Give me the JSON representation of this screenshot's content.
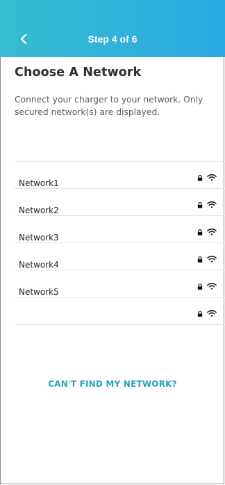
{
  "header": {
    "title": "Step 4 of 6",
    "back_icon": "chevron-left-icon",
    "gradient": [
      "#36bcd0",
      "#2aa9e3"
    ]
  },
  "page": {
    "title": "Choose A Network",
    "subtitle": "Connect your charger to your network.  Only secured network(s) are displayed."
  },
  "networks": [
    {
      "name": "Network1",
      "icons": [
        "lock-icon",
        "wifi-icon"
      ]
    },
    {
      "name": "Network2",
      "icons": [
        "lock-icon",
        "wifi-icon"
      ]
    },
    {
      "name": "Network3",
      "icons": [
        "lock-icon",
        "wifi-icon"
      ]
    },
    {
      "name": "Network4",
      "icons": [
        "lock-icon",
        "wifi-icon"
      ]
    },
    {
      "name": "Network5",
      "icons": [
        "lock-icon",
        "wifi-icon"
      ]
    },
    {
      "name": "",
      "icons": [
        "lock-icon",
        "wifi-icon"
      ]
    }
  ],
  "footer": {
    "cant_find_label": "CAN'T FIND MY NETWORK?",
    "accent_color": "#26a3bf"
  }
}
